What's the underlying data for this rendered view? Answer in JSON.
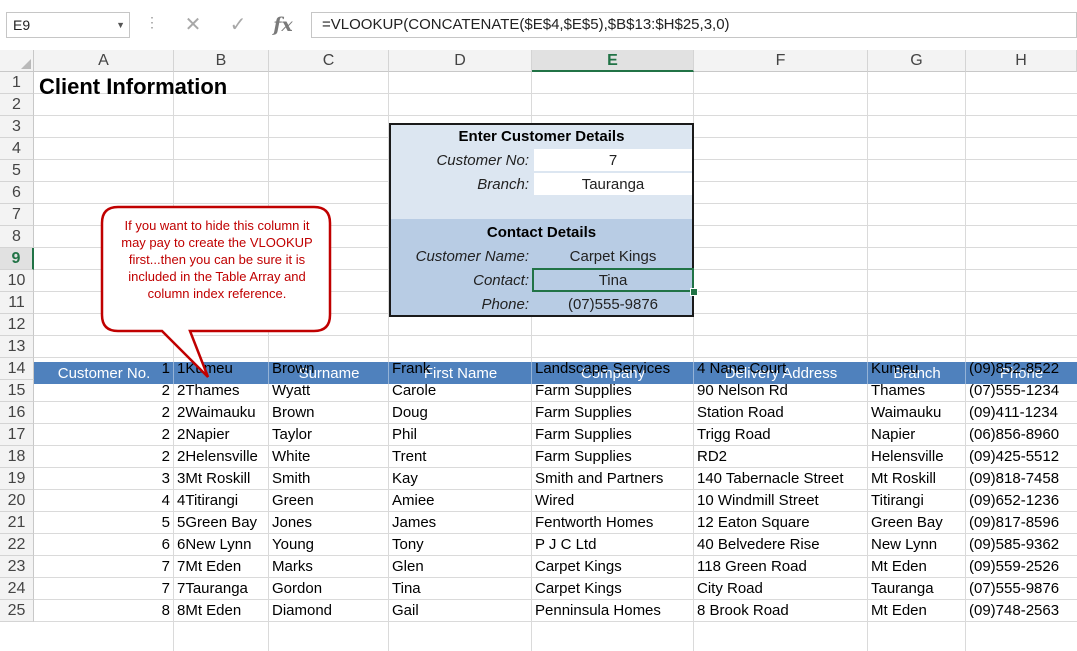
{
  "formula_bar": {
    "name_box": "E9",
    "name_box_arrow": "▼",
    "dots": "⋮",
    "cancel_icon": "✕",
    "enter_icon": "✓",
    "fx_label": "fx",
    "formula": "=VLOOKUP(CONCATENATE($E$4,$E$5),$B$13:$H$25,3,0)"
  },
  "columns": [
    "A",
    "B",
    "C",
    "D",
    "E",
    "F",
    "G",
    "H"
  ],
  "rows": [
    "1",
    "2",
    "3",
    "4",
    "5",
    "6",
    "7",
    "8",
    "9",
    "10",
    "11",
    "12",
    "13",
    "14",
    "15",
    "16",
    "17",
    "18",
    "19",
    "20",
    "21",
    "22",
    "23",
    "24",
    "25"
  ],
  "active_column": "E",
  "active_row": "9",
  "sheet_title": "Client Information",
  "panel": {
    "heading_enter": "Enter Customer Details",
    "customer_no_label": "Customer No:",
    "customer_no_value": "7",
    "branch_label": "Branch:",
    "branch_value": "Tauranga",
    "heading_contact": "Contact Details",
    "customer_name_label": "Customer Name:",
    "customer_name_value": "Carpet Kings",
    "contact_label": "Contact:",
    "contact_value": "Tina",
    "phone_label": "Phone:",
    "phone_value": "(07)555-9876"
  },
  "callout": {
    "text": "If you want to hide this column it may pay to create the VLOOKUP first...then you can be sure it is included in the Table Array and column index reference."
  },
  "table": {
    "headers": [
      "Customer No.",
      "",
      "Surname",
      "First Name",
      "Company",
      "Delivery Address",
      "Branch",
      "Phone"
    ],
    "rows": [
      [
        "1",
        "1Kumeu",
        "Brown",
        "Frank",
        "Landscape Services",
        "4 Nane Court",
        "Kumeu",
        "(09)852-8522"
      ],
      [
        "2",
        "2Thames",
        "Wyatt",
        "Carole",
        "Farm Supplies",
        "90 Nelson Rd",
        "Thames",
        "(07)555-1234"
      ],
      [
        "2",
        "2Waimauku",
        "Brown",
        "Doug",
        "Farm Supplies",
        "Station Road",
        "Waimauku",
        "(09)411-1234"
      ],
      [
        "2",
        "2Napier",
        "Taylor",
        "Phil",
        "Farm Supplies",
        "Trigg Road",
        "Napier",
        "(06)856-8960"
      ],
      [
        "2",
        "2Helensville",
        "White",
        "Trent",
        "Farm Supplies",
        "RD2",
        "Helensville",
        "(09)425-5512"
      ],
      [
        "3",
        "3Mt Roskill",
        "Smith",
        "Kay",
        "Smith and Partners",
        "140 Tabernacle Street",
        "Mt Roskill",
        "(09)818-7458"
      ],
      [
        "4",
        "4Titirangi",
        "Green",
        "Amiee",
        "Wired",
        "10 Windmill Street",
        "Titirangi",
        "(09)652-1236"
      ],
      [
        "5",
        "5Green Bay",
        "Jones",
        "James",
        "Fentworth Homes",
        "12 Eaton Square",
        "Green Bay",
        "(09)817-8596"
      ],
      [
        "6",
        "6New Lynn",
        "Young",
        "Tony",
        "P J C Ltd",
        "40 Belvedere Rise",
        "New Lynn",
        "(09)585-9362"
      ],
      [
        "7",
        "7Mt Eden",
        "Marks",
        "Glen",
        "Carpet Kings",
        "118 Green Road",
        "Mt Eden",
        "(09)559-2526"
      ],
      [
        "7",
        "7Tauranga",
        "Gordon",
        "Tina",
        "Carpet Kings",
        "City Road",
        "Tauranga",
        "(07)555-9876"
      ],
      [
        "8",
        "8Mt Eden",
        "Diamond",
        "Gail",
        "Penninsula Homes",
        "8 Brook Road",
        "Mt Eden",
        "(09)748-2563"
      ]
    ]
  },
  "colors": {
    "header_blue": "#4f81bd",
    "panel_light": "#dce6f1",
    "panel_dark": "#b8cce4",
    "excel_green": "#217346",
    "callout_red": "#c00000"
  }
}
